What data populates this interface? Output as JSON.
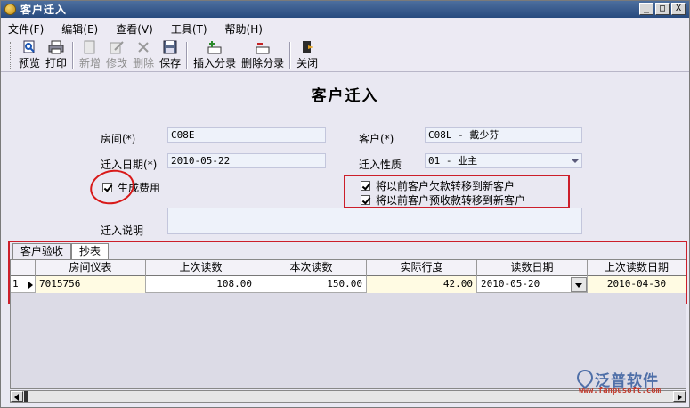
{
  "window": {
    "title": "客户迁入",
    "min": "_",
    "max": "□",
    "close": "X"
  },
  "menu": [
    "文件(F)",
    "编辑(E)",
    "查看(V)",
    "工具(T)",
    "帮助(H)"
  ],
  "toolbar": {
    "preview": "预览",
    "print": "打印",
    "add": "新增",
    "edit": "修改",
    "delete": "删除",
    "save": "保存",
    "insert_entry": "插入分录",
    "delete_entry": "删除分录",
    "close": "关闭"
  },
  "form": {
    "title": "客户迁入",
    "room_label": "房间(*)",
    "room_value": "C08E",
    "customer_label": "客户(*)",
    "customer_value": "C08L - 戴少芬",
    "date_label": "迁入日期(*)",
    "date_value": "2010-05-22",
    "nature_label": "迁入性质",
    "nature_value": "01 - 业主",
    "gen_fee_label": "生成费用",
    "transfer_arrears_label": "将以前客户欠款转移到新客户",
    "transfer_prepaid_label": "将以前客户预收款转移到新客户",
    "remark_label": "迁入说明"
  },
  "tabs": [
    "客户验收",
    "抄表"
  ],
  "grid": {
    "headers": [
      "房间仪表",
      "上次读数",
      "本次读数",
      "实际行度",
      "读数日期",
      "上次读数日期"
    ],
    "rows": [
      {
        "no": "1",
        "meter": "7015756",
        "last": "108.00",
        "current": "150.00",
        "actual": "42.00",
        "date": "2010-05-20",
        "last_date": "2010-04-30"
      }
    ]
  },
  "watermark": {
    "name": "泛普软件",
    "url": "www.fanpusoft.com"
  }
}
